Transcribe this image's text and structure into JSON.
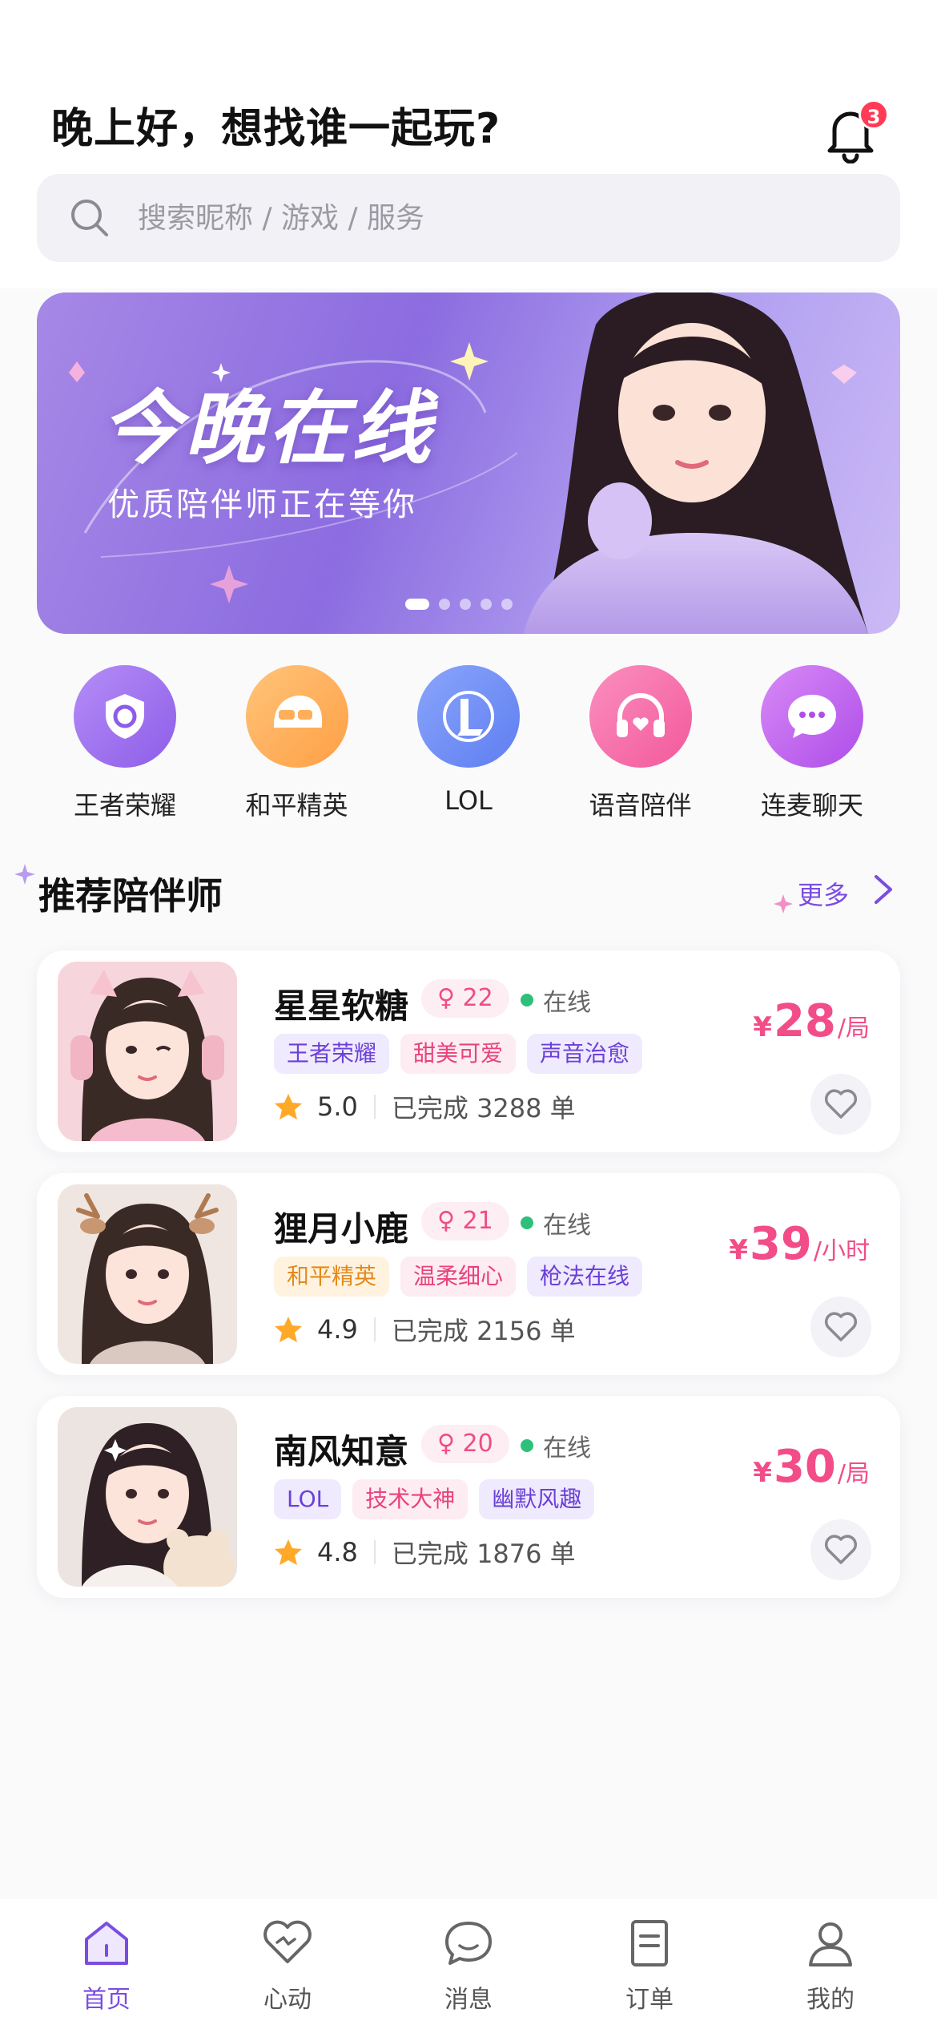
{
  "header": {
    "greeting": "晚上好，想找谁一起玩?",
    "notification_count": "3"
  },
  "search": {
    "placeholder": "搜索昵称 / 游戏 / 服务"
  },
  "banner": {
    "title": "今晚在线",
    "subtitle": "优质陪伴师正在等你",
    "page_count": 5,
    "active_page": 1
  },
  "categories": [
    {
      "label": "王者荣耀",
      "icon": "shield-icon",
      "color": "#9b6cf0"
    },
    {
      "label": "和平精英",
      "icon": "helmet-icon",
      "color": "#ffae5a"
    },
    {
      "label": "LOL",
      "icon": "lol-logo-icon",
      "color": "#6b8bf5"
    },
    {
      "label": "语音陪伴",
      "icon": "headphones-icon",
      "color": "#f56aa6"
    },
    {
      "label": "连麦聊天",
      "icon": "chat-bubble-icon",
      "color": "#c064f2"
    }
  ],
  "section": {
    "title": "推荐陪伴师",
    "more_label": "更多"
  },
  "companions": [
    {
      "name": "星星软糖",
      "age": "♀ 22",
      "status": "在线",
      "tags": [
        {
          "text": "王者荣耀",
          "style": "purple"
        },
        {
          "text": "甜美可爱",
          "style": "pink"
        },
        {
          "text": "声音治愈",
          "style": "purple"
        }
      ],
      "rating": "5.0",
      "completed": "已完成 3288 单",
      "currency": "¥",
      "price": "28",
      "unit": "/局"
    },
    {
      "name": "狸月小鹿",
      "age": "♀ 21",
      "status": "在线",
      "tags": [
        {
          "text": "和平精英",
          "style": "orange"
        },
        {
          "text": "温柔细心",
          "style": "pink"
        },
        {
          "text": "枪法在线",
          "style": "purple"
        }
      ],
      "rating": "4.9",
      "completed": "已完成 2156 单",
      "currency": "¥",
      "price": "39",
      "unit": "/小时"
    },
    {
      "name": "南风知意",
      "age": "♀ 20",
      "status": "在线",
      "tags": [
        {
          "text": "LOL",
          "style": "purple"
        },
        {
          "text": "技术大神",
          "style": "pink"
        },
        {
          "text": "幽默风趣",
          "style": "purple"
        }
      ],
      "rating": "4.8",
      "completed": "已完成 1876 单",
      "currency": "¥",
      "price": "30",
      "unit": "/局"
    }
  ],
  "tabbar": [
    {
      "label": "首页",
      "icon": "home-icon",
      "active": true
    },
    {
      "label": "心动",
      "icon": "heart-icon",
      "active": false
    },
    {
      "label": "消息",
      "icon": "message-icon",
      "active": false
    },
    {
      "label": "订单",
      "icon": "order-icon",
      "active": false
    },
    {
      "label": "我的",
      "icon": "profile-icon",
      "active": false
    }
  ],
  "colors": {
    "accent": "#7a4de0",
    "price": "#f24d88",
    "online": "#2ec07a",
    "badge": "#ff3b55"
  }
}
